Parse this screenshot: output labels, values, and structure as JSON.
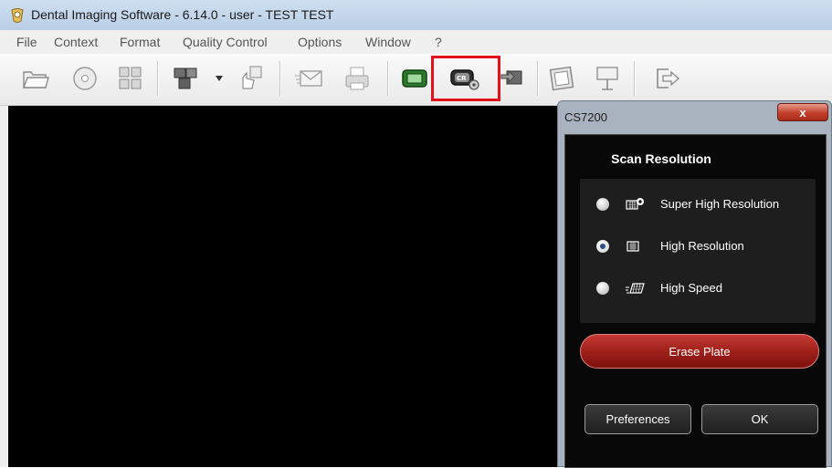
{
  "window": {
    "title": "Dental Imaging Software - 6.14.0 - user  - TEST TEST"
  },
  "menu": {
    "items": [
      "File",
      "Context",
      "Format",
      "Quality Control",
      "Options",
      "Window",
      "?"
    ]
  },
  "toolbar": {
    "icons": [
      "open-folder-icon",
      "cd-icon",
      "layout-icon",
      "screens-icon",
      "dropdown-arrow-icon",
      "touch-icon",
      "email-icon",
      "print-icon",
      "sensor-icon",
      "cr-scanner-icon",
      "transfer-icon",
      "frame-icon",
      "presentation-icon",
      "exit-icon"
    ],
    "highlighted": "cr-scanner-icon",
    "highlight_color": "#e2121b"
  },
  "dialog": {
    "title": "CS7200",
    "close_label": "x",
    "section_title": "Scan Resolution",
    "options": [
      {
        "label": "Super High Resolution",
        "icon": "super-high-res-icon",
        "selected": false
      },
      {
        "label": "High Resolution",
        "icon": "high-res-icon",
        "selected": true
      },
      {
        "label": "High Speed",
        "icon": "high-speed-icon",
        "selected": false
      }
    ],
    "erase_label": "Erase Plate",
    "preferences_label": "Preferences",
    "ok_label": "OK"
  },
  "colors": {
    "canvas": "#000000",
    "erase_button": "#9c1e19",
    "close_button": "#c3402b"
  }
}
